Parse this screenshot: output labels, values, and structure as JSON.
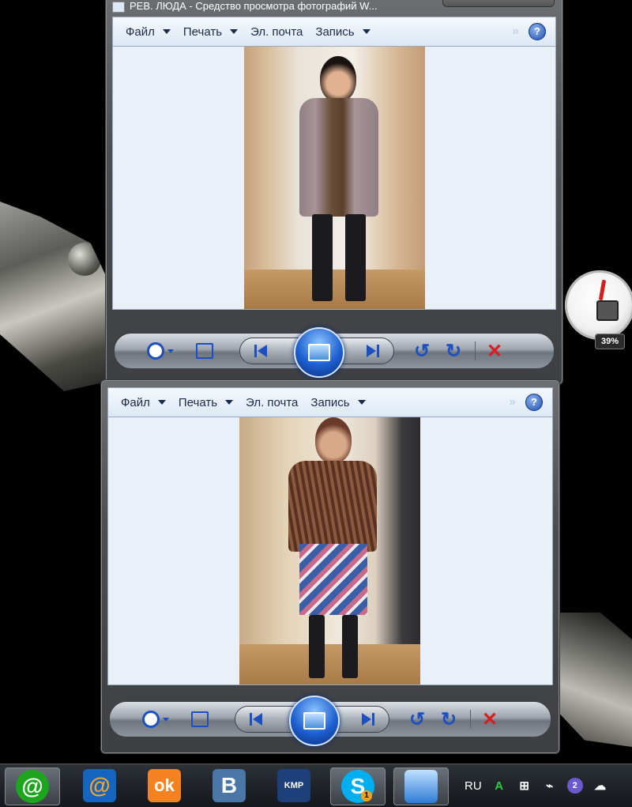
{
  "desktop": {
    "gadget": {
      "name": "cpu-meter-gadget",
      "value_label": "39%"
    }
  },
  "window1": {
    "title": "PEB. ЛЮДА - Средство просмотра фотографий W...",
    "menu": [
      "Файл",
      "Печать",
      "Эл. почта",
      "Запись"
    ],
    "more": "»",
    "help": "?",
    "toolbar": {
      "zoom": "zoom-icon",
      "fit": "actual-size-icon",
      "prev": "previous-icon",
      "slideshow": "slideshow-icon",
      "next": "next-icon",
      "rotate_ccw": "↺",
      "rotate_cw": "↻",
      "delete": "✕"
    }
  },
  "window2": {
    "menu": [
      "Файл",
      "Печать",
      "Эл. почта",
      "Запись"
    ],
    "more": "»",
    "help": "?",
    "toolbar": {
      "rotate_ccw": "↺",
      "rotate_cw": "↻",
      "delete": "✕"
    }
  },
  "taskbar": {
    "apps": [
      {
        "name": "agent-mail-ru",
        "glyph": "@",
        "color": "#1ea51e"
      },
      {
        "name": "mail-ru",
        "glyph": "@",
        "color": "#1565c0"
      },
      {
        "name": "odnoklassniki",
        "glyph": "ok",
        "color": "#f58220"
      },
      {
        "name": "vkontakte",
        "glyph": "B",
        "color": "#4a76a8"
      },
      {
        "name": "kmplayer",
        "glyph": "KMP",
        "color": "#1d3f7a"
      },
      {
        "name": "skype",
        "glyph": "S",
        "color": "#00aff0",
        "badge": "1"
      },
      {
        "name": "photo-viewer",
        "glyph": "",
        "color": "#2e7bd6"
      }
    ],
    "tray": {
      "language": "RU",
      "badge_count": "2"
    }
  }
}
